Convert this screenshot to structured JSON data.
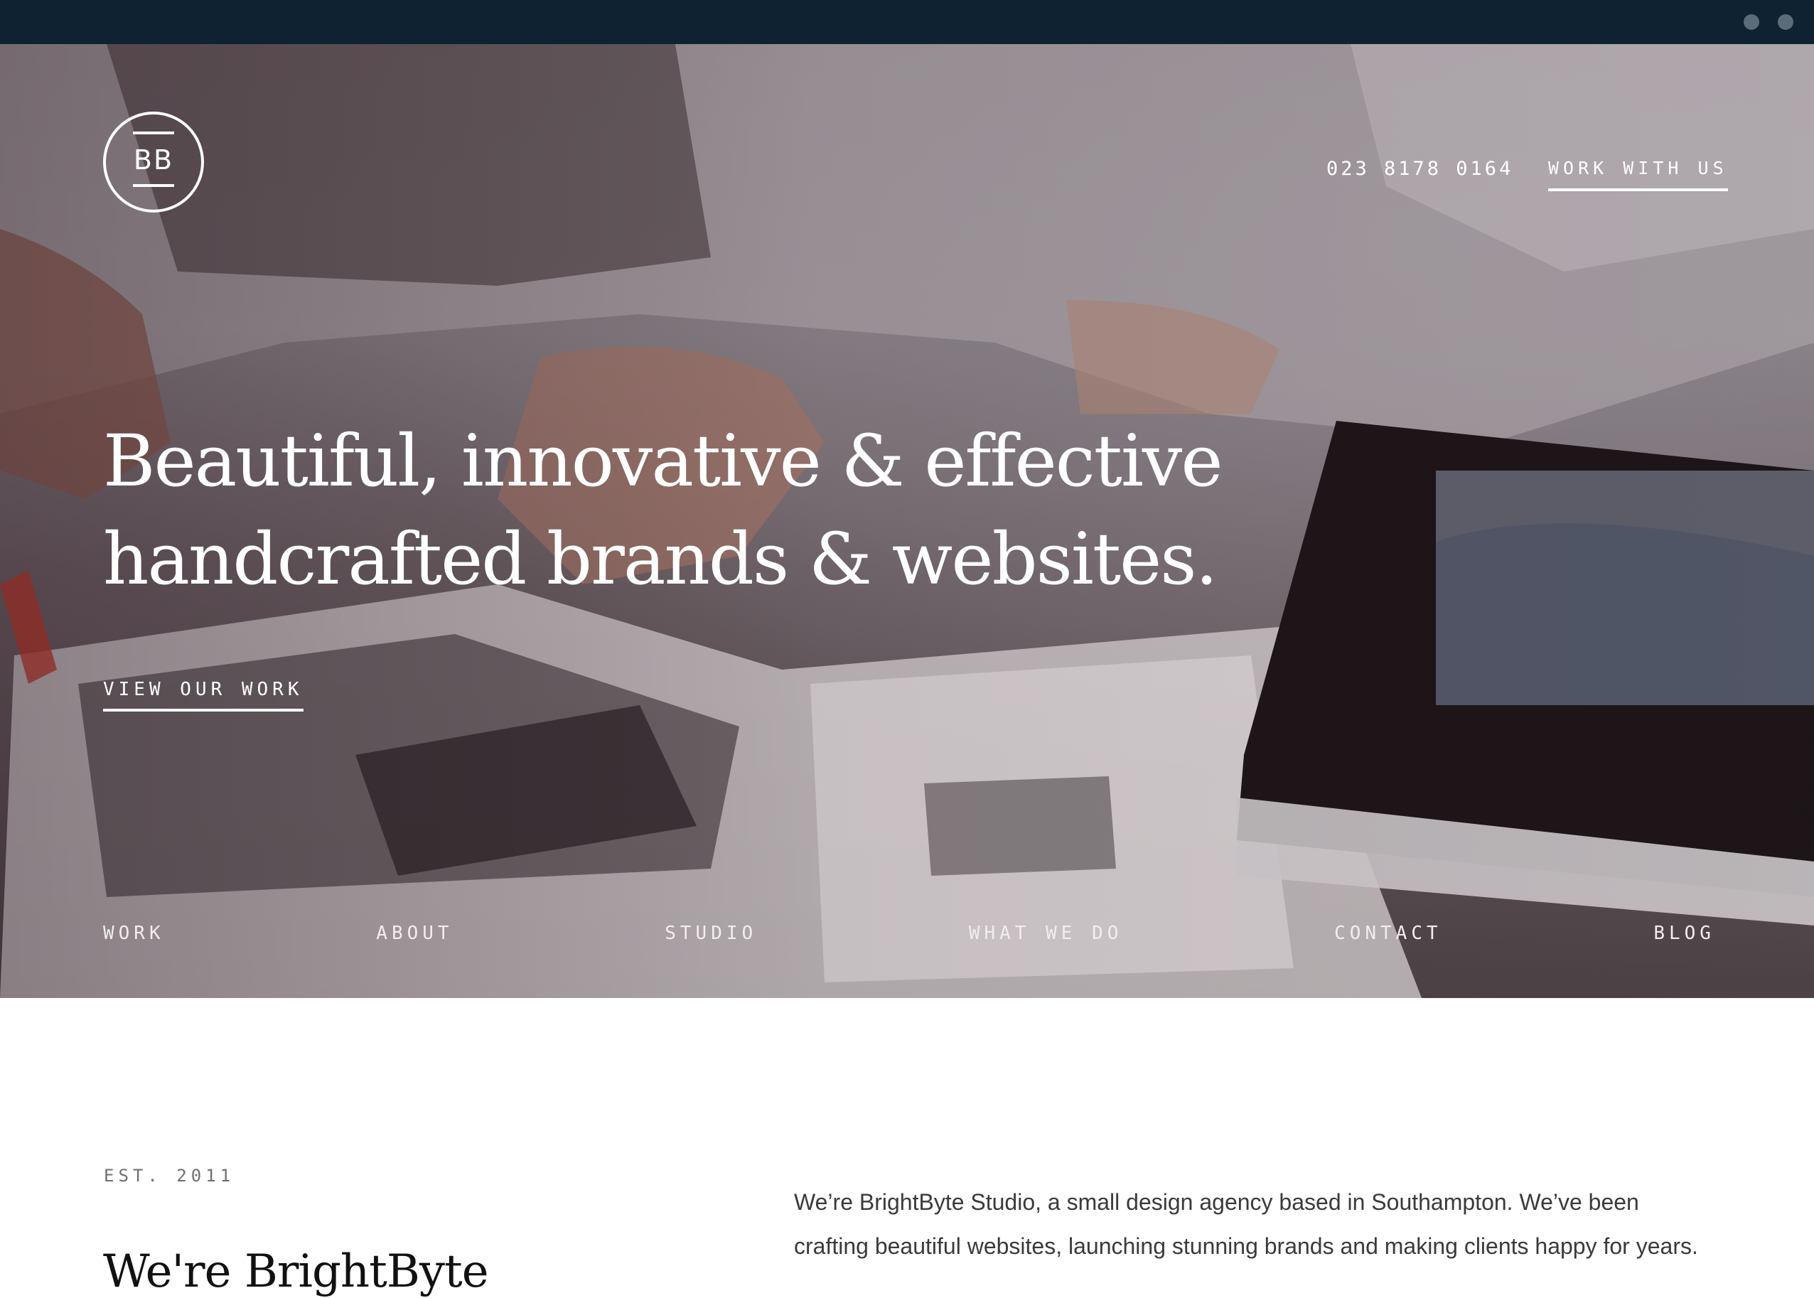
{
  "brand": {
    "logo_text": "BB"
  },
  "header": {
    "phone": "023 8178 0164",
    "cta_label": "WORK WITH US"
  },
  "hero": {
    "headline_line1": "Beautiful, innovative & effective",
    "headline_line2": "handcrafted brands & websites.",
    "cta_label": "VIEW OUR WORK"
  },
  "nav": {
    "items": [
      {
        "label": "WORK"
      },
      {
        "label": "ABOUT"
      },
      {
        "label": "STUDIO"
      },
      {
        "label": "WHAT WE DO"
      },
      {
        "label": "CONTACT"
      },
      {
        "label": "BLOG"
      }
    ]
  },
  "intro": {
    "est": "EST. 2011",
    "heading": "We're BrightByte",
    "text": "We’re BrightByte Studio, a small design agency based in Southampton. We’ve been crafting beautiful websites, launching stunning brands and making clients happy for years."
  },
  "colors": {
    "browser_bar": "#0e2231",
    "hero_text": "#ffffff",
    "body_text": "#3a3a3a"
  },
  "icons": [
    "window-dot-icon",
    "logo-mark-icon"
  ]
}
